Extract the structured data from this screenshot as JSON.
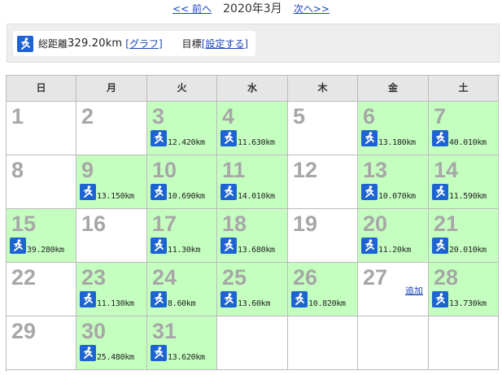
{
  "nav": {
    "prev": "<< 前へ",
    "month": "2020年3月",
    "next": "次へ>>"
  },
  "summary": {
    "total_label": "総距離",
    "total_value": "329.20km",
    "graph_link": "[グラフ]",
    "goal_label": "目標",
    "goal_link": "[設定する]"
  },
  "colors": {
    "run_day_bg": "#c5ffc0",
    "icon_bg": "#1e63d2",
    "link": "#1a44b8"
  },
  "weekdays": [
    "日",
    "月",
    "火",
    "水",
    "木",
    "金",
    "土"
  ],
  "add_label": "追加",
  "days": [
    {
      "day": "1",
      "distance": ""
    },
    {
      "day": "2",
      "distance": ""
    },
    {
      "day": "3",
      "distance": "12.420km"
    },
    {
      "day": "4",
      "distance": "11.630km"
    },
    {
      "day": "5",
      "distance": ""
    },
    {
      "day": "6",
      "distance": "13.180km"
    },
    {
      "day": "7",
      "distance": "40.010km"
    },
    {
      "day": "8",
      "distance": ""
    },
    {
      "day": "9",
      "distance": "13.150km"
    },
    {
      "day": "10",
      "distance": "10.690km"
    },
    {
      "day": "11",
      "distance": "14.010km"
    },
    {
      "day": "12",
      "distance": ""
    },
    {
      "day": "13",
      "distance": "10.070km"
    },
    {
      "day": "14",
      "distance": "11.590km"
    },
    {
      "day": "15",
      "distance": "39.280km"
    },
    {
      "day": "16",
      "distance": ""
    },
    {
      "day": "17",
      "distance": "11.30km"
    },
    {
      "day": "18",
      "distance": "13.680km"
    },
    {
      "day": "19",
      "distance": ""
    },
    {
      "day": "20",
      "distance": "11.20km"
    },
    {
      "day": "21",
      "distance": "20.010km"
    },
    {
      "day": "22",
      "distance": ""
    },
    {
      "day": "23",
      "distance": "11.130km"
    },
    {
      "day": "24",
      "distance": "8.60km"
    },
    {
      "day": "25",
      "distance": "13.60km"
    },
    {
      "day": "26",
      "distance": "10.820km"
    },
    {
      "day": "27",
      "distance": "",
      "add": true
    },
    {
      "day": "28",
      "distance": "13.730km"
    },
    {
      "day": "29",
      "distance": ""
    },
    {
      "day": "30",
      "distance": "25.480km"
    },
    {
      "day": "31",
      "distance": "13.620km"
    }
  ]
}
